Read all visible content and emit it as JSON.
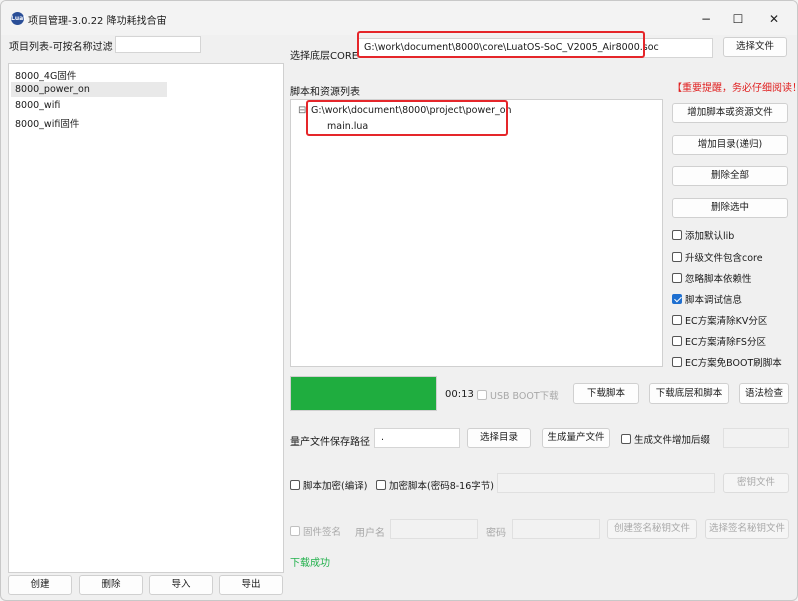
{
  "window": {
    "title": "项目管理-3.0.22 降功耗找合宙",
    "icon_text": "Luat",
    "controls": {
      "minimize": "−",
      "maximize": "☐",
      "close": "✕"
    }
  },
  "project_list": {
    "filter_label": "项目列表-可按名称过滤",
    "filter_value": "",
    "items": [
      "8000_4G固件",
      "8000_power_on",
      "8000_wifi",
      "8000_wifi固件"
    ],
    "selected": "8000_power_on",
    "buttons": {
      "create": "创建",
      "delete": "删除",
      "import": "导入",
      "export": "导出"
    }
  },
  "core": {
    "label": "选择底层CORE",
    "path": "G:\\work\\document\\8000\\core\\LuatOS-SoC_V2005_Air8000.soc",
    "select_button": "选择文件"
  },
  "scripts": {
    "label": "脚本和资源列表",
    "warning": "【重要提醒，务必仔细阅读！】",
    "tree_toggle": "⊟",
    "tree_root": "G:\\work\\document\\8000\\project\\power_on",
    "tree_child": "main.lua",
    "buttons": {
      "add_script": "增加脚本或资源文件",
      "add_dir": "增加目录(递归)",
      "delete_all": "删除全部",
      "delete_selected": "删除选中"
    },
    "options": [
      {
        "label": "添加默认lib",
        "checked": false
      },
      {
        "label": "升级文件包含core",
        "checked": false
      },
      {
        "label": "忽略脚本依赖性",
        "checked": false
      },
      {
        "label": "脚本调试信息",
        "checked": true
      },
      {
        "label": "EC方案清除KV分区",
        "checked": false
      },
      {
        "label": "EC方案清除FS分区",
        "checked": false
      },
      {
        "label": "EC方案免BOOT刷脚本",
        "checked": false
      }
    ]
  },
  "download": {
    "progress": 1.0,
    "progress_color": "#1fad3f",
    "time": "00:13",
    "usb_boot_label": "USB BOOT下载",
    "download_script": "下载脚本",
    "download_core_script": "下载底层和脚本",
    "syntax_check": "语法检查"
  },
  "production": {
    "path_label": "量产文件保存路径",
    "path_value": ".",
    "select_dir": "选择目录",
    "generate": "生成量产文件",
    "suffix_label": "生成文件增加后缀",
    "suffix_value": ""
  },
  "encryption": {
    "encrypt_compile": "脚本加密(编译)",
    "encrypt_key": "加密脚本(密码8-16字节)",
    "key_value": "",
    "key_file": "密钥文件"
  },
  "firmware_sign": {
    "label": "固件签名",
    "user_label": "用户名",
    "password_label": "密码",
    "create_key": "创建签名秘钥文件",
    "select_key": "选择签名秘钥文件"
  },
  "status": {
    "text": "下载成功",
    "color": "#22b14c"
  },
  "colors": {
    "highlight": "#e5262a",
    "warning": "#e02020",
    "accent": "#1e6fd0"
  }
}
